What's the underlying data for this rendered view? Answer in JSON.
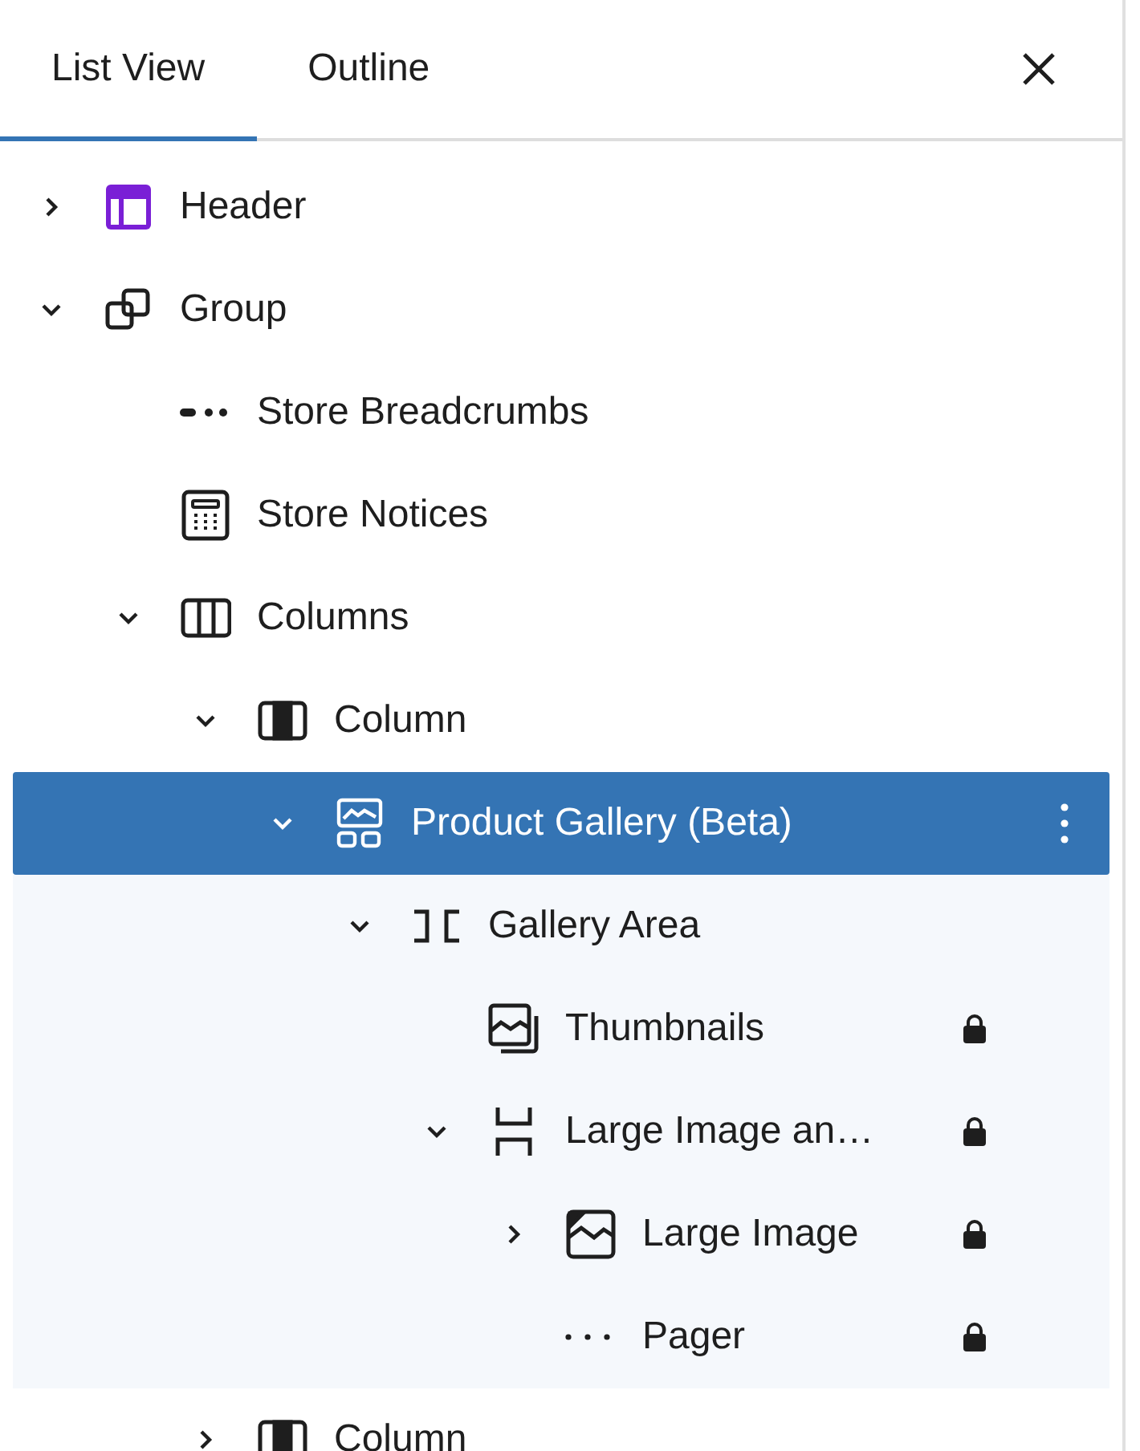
{
  "tabs": [
    {
      "label": "List View",
      "selected": true
    },
    {
      "label": "Outline",
      "selected": false
    }
  ],
  "tree": [
    {
      "label": "Header",
      "kind": "header",
      "expanded": false,
      "selected": false,
      "locked": false
    },
    {
      "label": "Group",
      "kind": "group",
      "expanded": true,
      "selected": false,
      "locked": false,
      "children": [
        {
          "label": "Store Breadcrumbs",
          "kind": "breadcrumbs",
          "selected": false,
          "locked": false
        },
        {
          "label": "Store Notices",
          "kind": "notices",
          "selected": false,
          "locked": false
        },
        {
          "label": "Columns",
          "kind": "columns",
          "expanded": true,
          "selected": false,
          "locked": false,
          "children": [
            {
              "label": "Column",
              "kind": "column",
              "expanded": true,
              "selected": false,
              "locked": false,
              "children": [
                {
                  "label": "Product Gallery (Beta)",
                  "kind": "gallery",
                  "expanded": true,
                  "selected": true,
                  "locked": false,
                  "children": [
                    {
                      "label": "Gallery Area",
                      "kind": "gallery-area",
                      "expanded": true,
                      "selected": false,
                      "locked": false,
                      "children": [
                        {
                          "label": "Thumbnails",
                          "kind": "thumbnails",
                          "selected": false,
                          "locked": true
                        },
                        {
                          "label": "Large Image an…",
                          "kind": "large-image-area",
                          "expanded": true,
                          "selected": false,
                          "locked": true,
                          "children": [
                            {
                              "label": "Large Image",
                              "kind": "image",
                              "expanded": false,
                              "selected": false,
                              "locked": true
                            },
                            {
                              "label": "Pager",
                              "kind": "pager",
                              "selected": false,
                              "locked": true
                            }
                          ]
                        }
                      ]
                    }
                  ]
                }
              ]
            },
            {
              "label": "Column",
              "kind": "column",
              "expanded": false,
              "selected": false,
              "locked": false
            }
          ]
        }
      ]
    }
  ]
}
